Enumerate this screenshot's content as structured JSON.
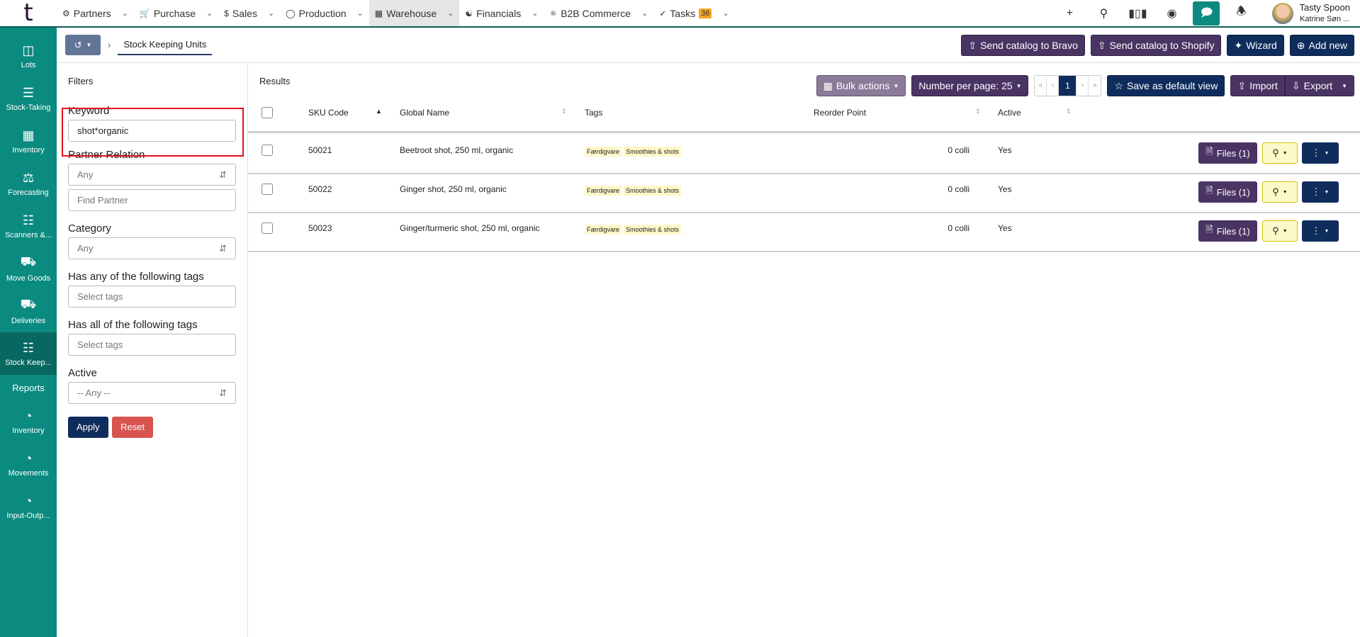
{
  "nav": {
    "items": [
      {
        "label": "Partners",
        "icon": "partners-icon"
      },
      {
        "label": "Purchase",
        "icon": "cart-icon"
      },
      {
        "label": "Sales",
        "icon": "sales-icon"
      },
      {
        "label": "Production",
        "icon": "production-icon"
      },
      {
        "label": "Warehouse",
        "icon": "warehouse-icon"
      },
      {
        "label": "Financials",
        "icon": "coins-icon"
      },
      {
        "label": "B2B Commerce",
        "icon": "b2b-icon"
      },
      {
        "label": "Tasks",
        "icon": "check-icon"
      }
    ],
    "tasks_badge": "36"
  },
  "user": {
    "name": "Tasty Spoon",
    "company": "Katrine Søn ..."
  },
  "sidebar": {
    "items": [
      "Lots",
      "Stock-Taking",
      "Inventory",
      "Forecasting",
      "Scanners &...",
      "Move Goods",
      "Deliveries",
      "Stock Keep..."
    ],
    "reports_heading": "Reports",
    "reports": [
      "Inventory",
      "Movements",
      "Input-Outp..."
    ]
  },
  "breadcrumb": {
    "current": "Stock Keeping Units"
  },
  "actions": {
    "send_bravo": "Send catalog to Bravo",
    "send_shopify": "Send catalog to Shopify",
    "wizard": "Wizard",
    "add_new": "Add new"
  },
  "filters": {
    "title": "Filters",
    "keyword_label": "Keyword",
    "keyword_value": "shot*organic",
    "partner_label": "Partner Relation",
    "partner_value": "Any",
    "find_partner": "Find Partner",
    "category_label": "Category",
    "category_value": "Any",
    "any_tags_label": "Has any of the following tags",
    "all_tags_label": "Has all of the following tags",
    "tags_placeholder": "Select tags",
    "active_label": "Active",
    "active_value": "-- Any --",
    "apply": "Apply",
    "reset": "Reset"
  },
  "results": {
    "title": "Results",
    "bulk": "Bulk actions",
    "per_page": "Number per page: 25",
    "page": "1",
    "save_view": "Save as default view",
    "import": "Import",
    "export": "Export",
    "columns": [
      "SKU Code",
      "Global Name",
      "Tags",
      "Reorder Point",
      "Active"
    ],
    "rows": [
      {
        "sku": "50021",
        "name": "Beetroot shot, 250 ml, organic",
        "tags": [
          "Færdigvare",
          "Smoothies & shots"
        ],
        "reorder": "0 colli",
        "active": "Yes",
        "files": "Files (1)"
      },
      {
        "sku": "50022",
        "name": "Ginger shot, 250 ml, organic",
        "tags": [
          "Færdigvare",
          "Smoothies & shots"
        ],
        "reorder": "0 colli",
        "active": "Yes",
        "files": "Files (1)"
      },
      {
        "sku": "50023",
        "name": "Ginger/turmeric shot, 250 ml, organic",
        "tags": [
          "Færdigvare",
          "Smoothies & shots"
        ],
        "reorder": "0 colli",
        "active": "Yes",
        "files": "Files (1)"
      }
    ]
  }
}
